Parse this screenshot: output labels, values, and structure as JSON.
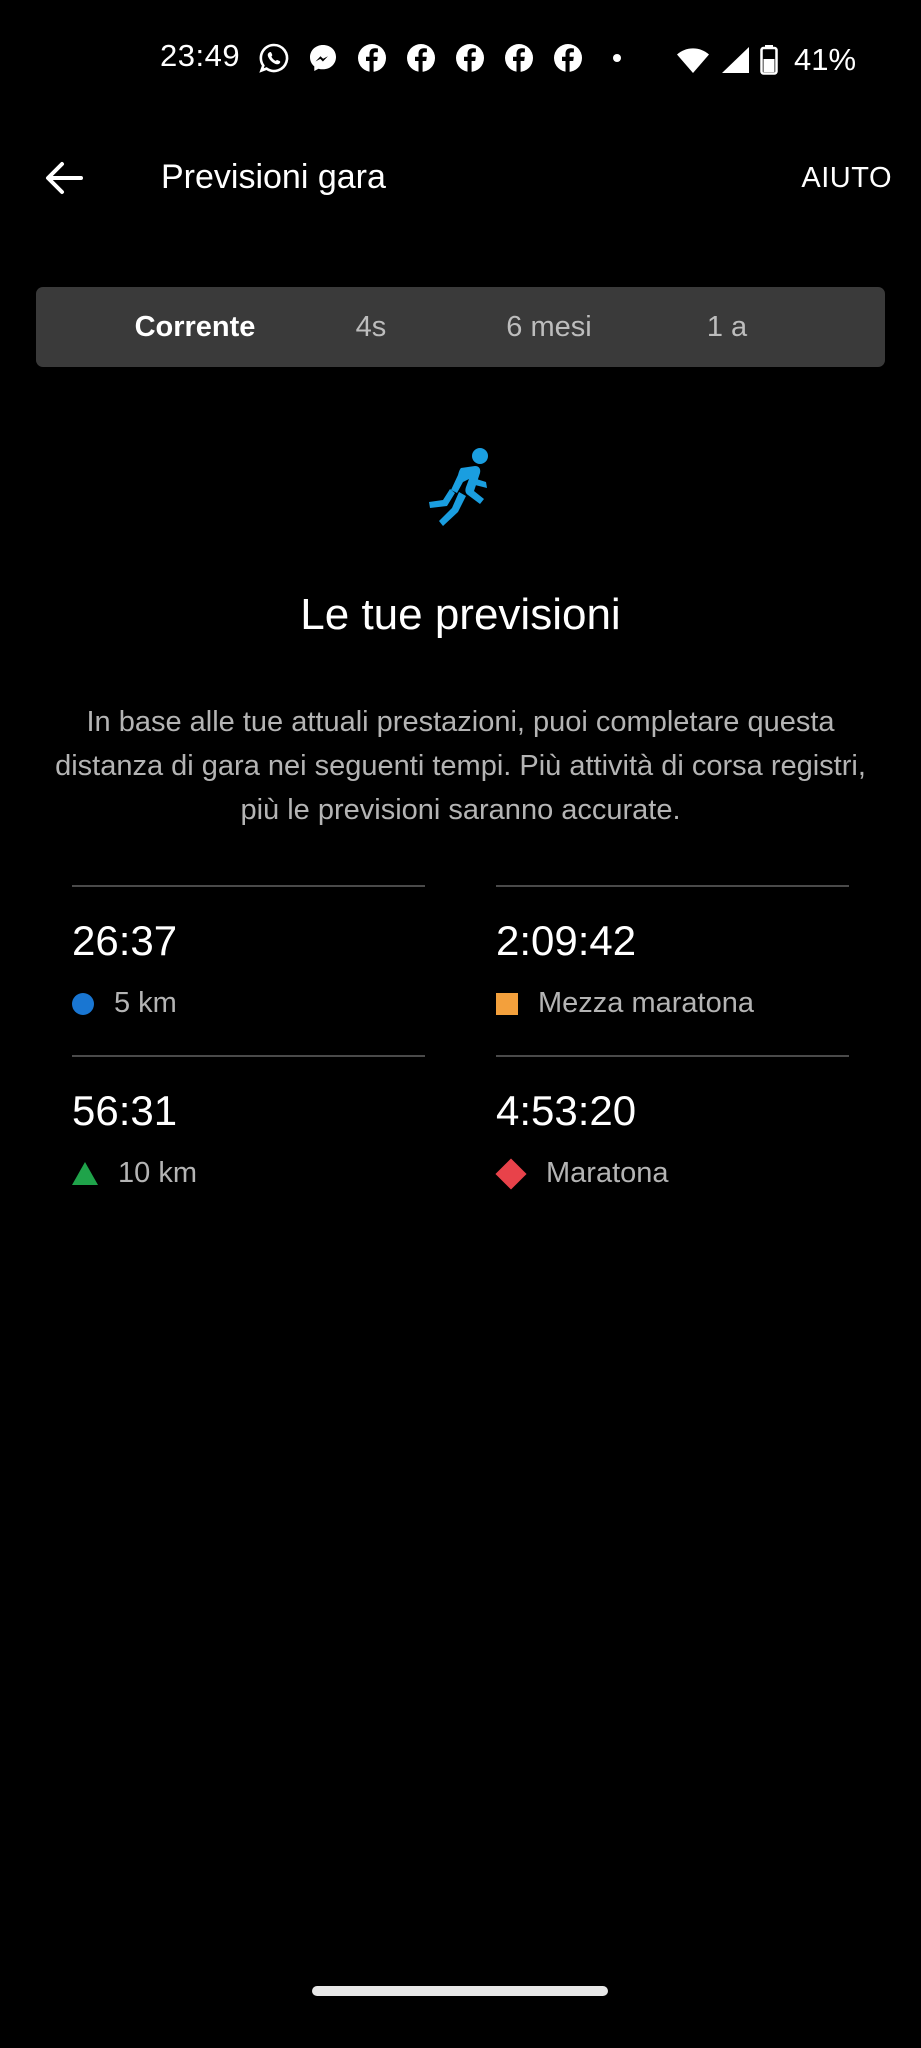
{
  "status_bar": {
    "time": "23:49",
    "notification_icons": [
      "whatsapp-icon",
      "messenger-icon",
      "facebook-icon",
      "facebook-icon",
      "facebook-icon",
      "facebook-icon",
      "facebook-icon"
    ],
    "battery_percent": "41%"
  },
  "app_bar": {
    "title": "Previsioni gara",
    "help_label": "AIUTO"
  },
  "tabs": [
    {
      "label": "Corrente",
      "active": true
    },
    {
      "label": "4s",
      "active": false
    },
    {
      "label": "6 mesi",
      "active": false
    },
    {
      "label": "1 a",
      "active": false
    }
  ],
  "summary": {
    "icon": "running-icon",
    "heading": "Le tue previsioni",
    "description": "In base alle tue attuali prestazioni, puoi completare questa distanza di gara nei seguenti tempi. Più attività di corsa registri, più le previsioni saranno accurate."
  },
  "predictions": [
    {
      "time": "26:37",
      "label": "5 km",
      "marker": "circle",
      "color": "#1976d2"
    },
    {
      "time": "2:09:42",
      "label": "Mezza maratona",
      "marker": "square",
      "color": "#f3a03c"
    },
    {
      "time": "56:31",
      "label": "10 km",
      "marker": "triangle",
      "color": "#1fa34a"
    },
    {
      "time": "4:53:20",
      "label": "Maratona",
      "marker": "diamond",
      "color": "#e8424a"
    }
  ],
  "colors": {
    "background": "#000000",
    "tab_bar": "#3a3a3a",
    "accent_icon": "#1a9ee0",
    "secondary_text": "#b4b4b4"
  }
}
